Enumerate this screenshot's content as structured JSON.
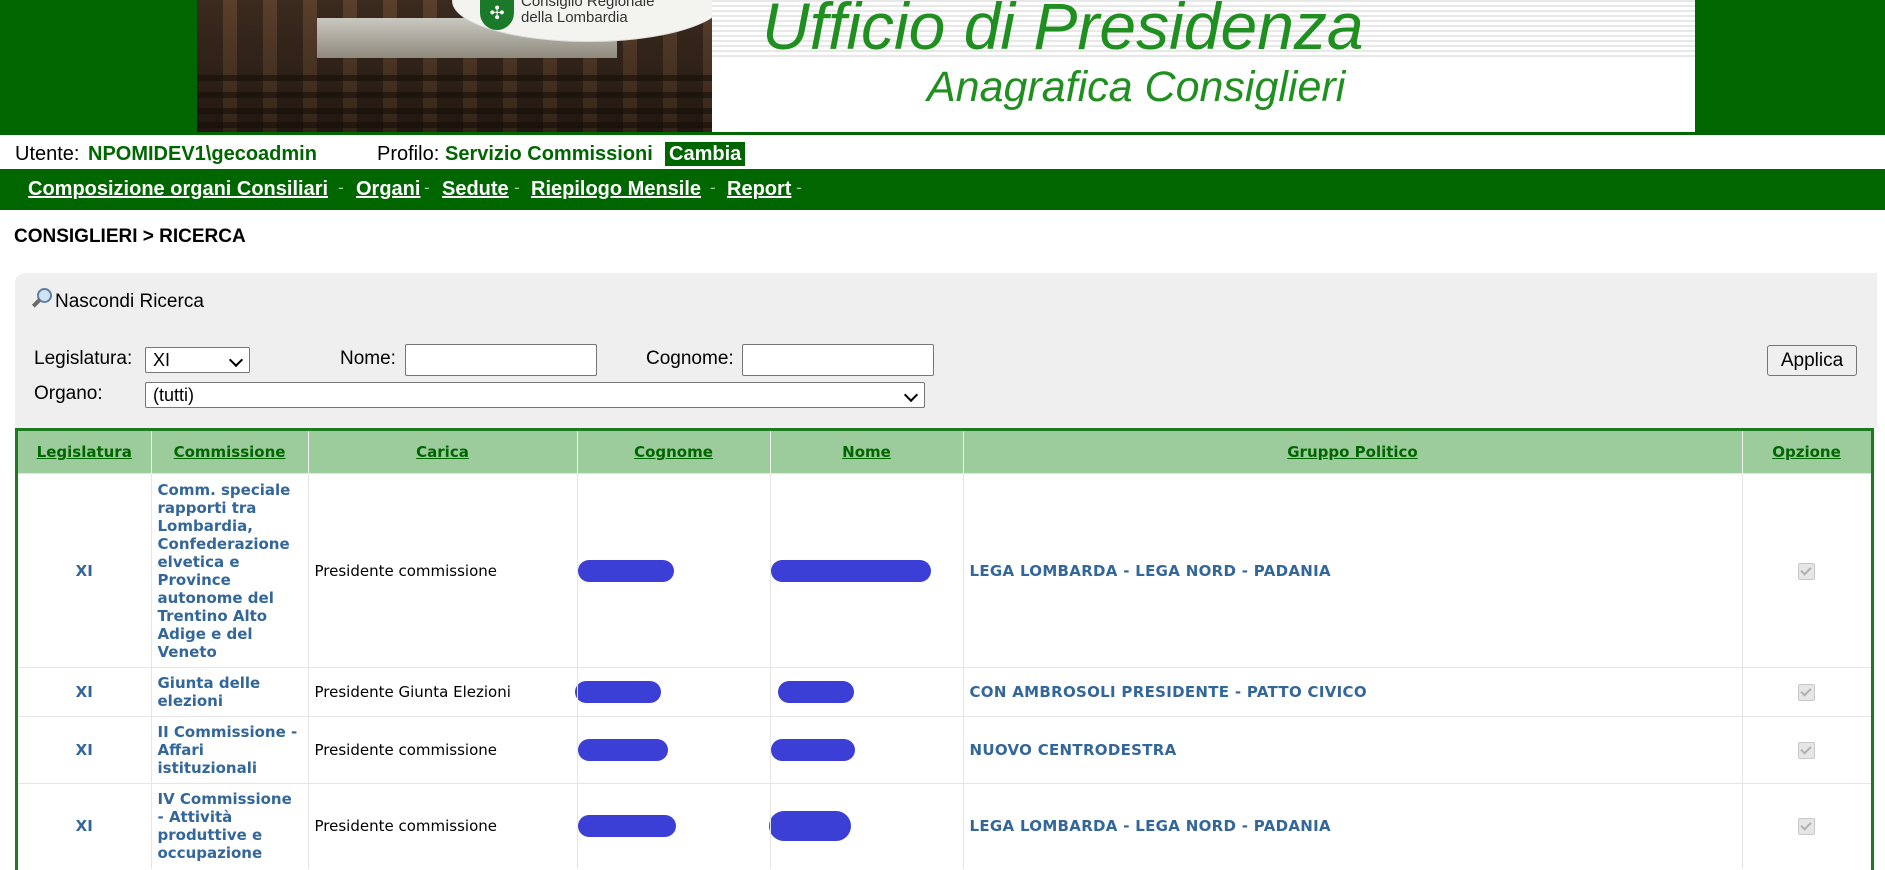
{
  "header": {
    "logo_text_line1": "Consiglio Regionale",
    "logo_text_line2": "della Lombardia",
    "title": "Ufficio di Presidenza",
    "subtitle": "Anagrafica Consiglieri"
  },
  "userbar": {
    "user_label": "Utente:",
    "user_value": "NPOMIDEV1\\gecoadmin",
    "profile_label": "Profilo:",
    "profile_value": "Servizio Commissioni",
    "change_label": "Cambia"
  },
  "menu": {
    "items": [
      {
        "label": "Composizione organi Consiliari"
      },
      {
        "label": "Organi"
      },
      {
        "label": "Sedute"
      },
      {
        "label": "Riepilogo Mensile"
      },
      {
        "label": "Report"
      }
    ]
  },
  "breadcrumb": "CONSIGLIERI > RICERCA",
  "search": {
    "toggle_label": "Nascondi Ricerca",
    "legislatura_label": "Legislatura:",
    "legislatura_value": "XI",
    "nome_label": "Nome:",
    "nome_value": "",
    "cognome_label": "Cognome:",
    "cognome_value": "",
    "organo_label": "Organo:",
    "organo_value": "(tutti)",
    "apply_label": "Applica"
  },
  "table": {
    "columns": [
      "Legislatura",
      "Commissione",
      "Carica",
      "Cognome",
      "Nome",
      "Gruppo Politico",
      "Opzione"
    ],
    "rows": [
      {
        "legislatura": "XI",
        "commissione": "Comm. speciale rapporti tra Lombardia, Confederazione elvetica e Province autonome del Trentino Alto Adige e del Veneto",
        "carica": "Presidente commissione",
        "gruppo": "LEGA LOMBARDA - LEGA NORD - PADANIA",
        "opzione": true
      },
      {
        "legislatura": "XI",
        "commissione": "Giunta delle elezioni",
        "carica": "Presidente Giunta Elezioni",
        "gruppo": "CON AMBROSOLI PRESIDENTE - PATTO CIVICO",
        "opzione": true
      },
      {
        "legislatura": "XI",
        "commissione": "II Commissione - Affari istituzionali",
        "carica": "Presidente commissione",
        "gruppo": "NUOVO CENTRODESTRA",
        "opzione": true
      },
      {
        "legislatura": "XI",
        "commissione": "IV Commissione - Attività produttive e occupazione",
        "carica": "Presidente commissione",
        "gruppo": "LEGA LOMBARDA - LEGA NORD - PADANIA",
        "opzione": true
      }
    ]
  },
  "colors": {
    "brand_green": "#006600",
    "header_bg": "#9ccc9c",
    "link_blue": "#336699",
    "redaction": "#3c3fd6"
  }
}
